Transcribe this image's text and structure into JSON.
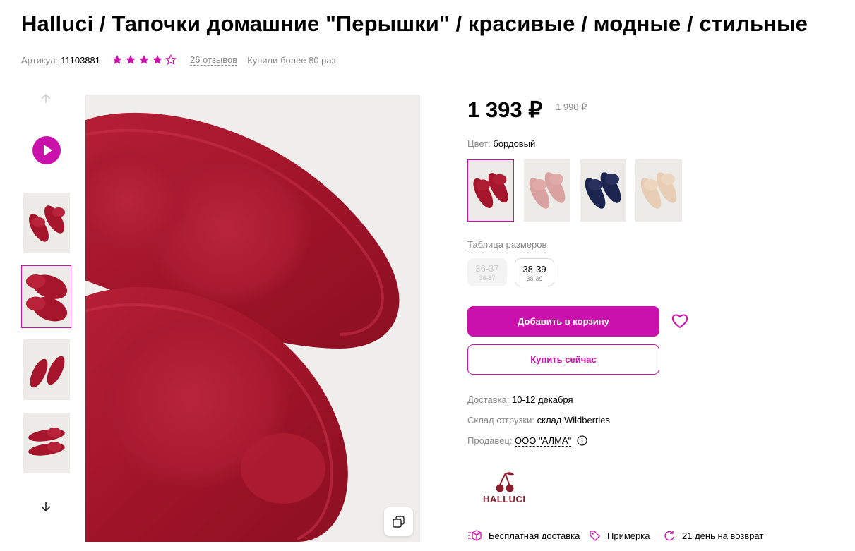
{
  "product": {
    "title": "Halluci / Тапочки домашние \"Перышки\" / красивые / модные / стильные",
    "article_label": "Артикул:",
    "article_value": "11103881",
    "rating": 4,
    "rating_max": 5,
    "reviews": "26 отзывов",
    "purchases": "Купили более 80 раз"
  },
  "gallery": {
    "thumbnail_count": 4,
    "active_index": 1,
    "icons": [
      "arrow-up-icon",
      "play-video-icon",
      "arrow-down-icon",
      "copy-icon"
    ]
  },
  "pricing": {
    "price": "1 393 ₽",
    "old_price": "1 990 ₽"
  },
  "color": {
    "label": "Цвет:",
    "value": "бордовый",
    "swatches": [
      {
        "name": "бордовый",
        "color": "#a5162c",
        "fur": "#b01e34"
      },
      {
        "name": "розовый",
        "color": "#d9a2a0",
        "fur": "#e0aaa9"
      },
      {
        "name": "синий",
        "color": "#1c2550",
        "fur": "#28315e"
      },
      {
        "name": "бежевый",
        "color": "#e6cdb4",
        "fur": "#edd6bf"
      }
    ]
  },
  "sizes": {
    "table_link": "Таблица размеров",
    "options": [
      {
        "main": "36-37",
        "sub": "36-37",
        "available": false
      },
      {
        "main": "38-39",
        "sub": "38-39",
        "available": true
      }
    ]
  },
  "actions": {
    "add_to_cart": "Добавить в корзину",
    "buy_now": "Купить сейчас"
  },
  "delivery": {
    "delivery_label": "Доставка:",
    "delivery_value": "10-12 декабря",
    "warehouse_label": "Склад отгрузки:",
    "warehouse_value": "склад Wildberries",
    "seller_label": "Продавец:",
    "seller_value": "ООО \"АЛМА\""
  },
  "brand": {
    "name": "HALLUCI"
  },
  "features": [
    {
      "label": "Бесплатная доставка",
      "icon": "box-icon"
    },
    {
      "label": "Примерка",
      "icon": "tag-icon"
    },
    {
      "label": "21 день на возврат",
      "icon": "return-icon"
    }
  ],
  "colors": {
    "accent": "#cb11ab",
    "muted_text": "#8a8a8a",
    "product_red": "#a5162c"
  }
}
